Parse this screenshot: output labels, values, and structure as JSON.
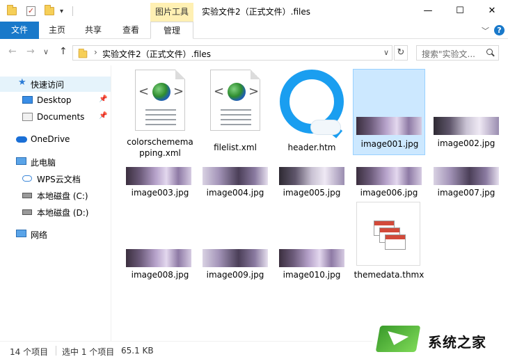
{
  "window": {
    "title": "实验文件2（正式文件）.files",
    "context_tab": "图片工具",
    "minimize": "—",
    "maximize": "☐",
    "close": "✕"
  },
  "ribbon": {
    "tabs": [
      "文件",
      "主页",
      "共享",
      "查看",
      "管理"
    ],
    "help": "?",
    "chevron": "﹀",
    "file_tab_color": "#1979ca"
  },
  "navigation": {
    "back": "←",
    "forward": "→",
    "recent": "∨",
    "up": "↑",
    "address_separator": "›",
    "address_path": "实验文件2（正式文件）.files",
    "refresh": "↻",
    "search_placeholder": "搜索\"实验文...",
    "dropdown": "∨"
  },
  "sidebar": {
    "items": [
      {
        "label": "快速访问",
        "icon": "star-icon",
        "pinned": false,
        "selected": true
      },
      {
        "label": "Desktop",
        "icon": "desktop-icon",
        "pinned": true
      },
      {
        "label": "Documents",
        "icon": "documents-icon",
        "pinned": true
      },
      {
        "label": "OneDrive",
        "icon": "cloud-icon"
      },
      {
        "label": "此电脑",
        "icon": "computer-icon"
      },
      {
        "label": "WPS云文档",
        "icon": "wps-cloud-icon"
      },
      {
        "label": "本地磁盘 (C:)",
        "icon": "drive-icon"
      },
      {
        "label": "本地磁盘 (D:)",
        "icon": "drive-icon"
      },
      {
        "label": "网络",
        "icon": "network-icon"
      }
    ],
    "pin_glyph": "📌"
  },
  "files": [
    {
      "name": "colorschememapping.xml",
      "line1": "colorschemema",
      "line2": "pping.xml",
      "type": "xml"
    },
    {
      "name": "filelist.xml",
      "type": "xml"
    },
    {
      "name": "header.htm",
      "type": "htm"
    },
    {
      "name": "image001.jpg",
      "type": "jpg",
      "selected": true
    },
    {
      "name": "image002.jpg",
      "type": "jpg"
    },
    {
      "name": "image003.jpg",
      "type": "jpg"
    },
    {
      "name": "image004.jpg",
      "type": "jpg"
    },
    {
      "name": "image005.jpg",
      "type": "jpg"
    },
    {
      "name": "image006.jpg",
      "type": "jpg"
    },
    {
      "name": "image007.jpg",
      "type": "jpg"
    },
    {
      "name": "image008.jpg",
      "type": "jpg"
    },
    {
      "name": "image009.jpg",
      "type": "jpg"
    },
    {
      "name": "image010.jpg",
      "type": "jpg"
    },
    {
      "name": "themedata.thmx",
      "type": "thmx"
    }
  ],
  "status": {
    "count": "14 个项目",
    "selection": "选中 1 个项目",
    "size": "65.1 KB"
  },
  "watermark": {
    "text": "系统之家"
  }
}
